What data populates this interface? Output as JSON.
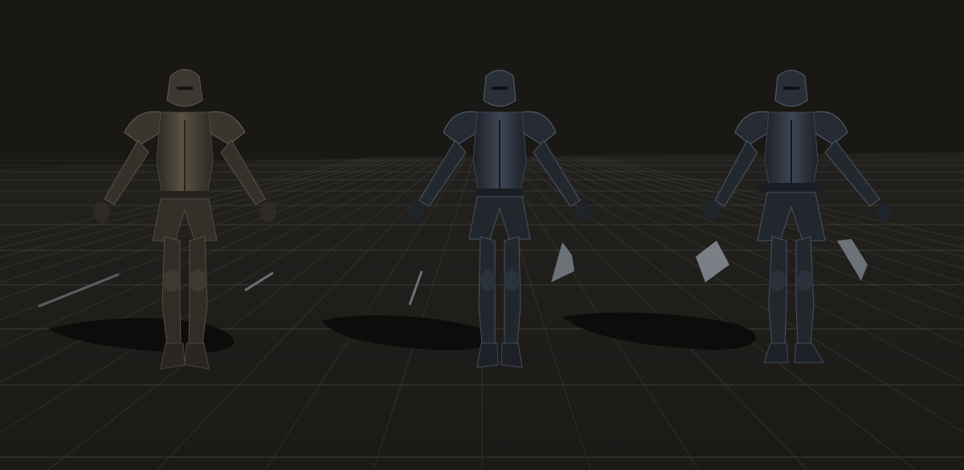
{
  "scene": {
    "colors": {
      "sky": "#1a1815",
      "floor_far": "#211f1c",
      "floor_near": "#1e1c19",
      "grid_line": "#4a4844",
      "shadow": "#0b0a09",
      "armor_bronze": "#3a3630",
      "armor_bronze_highlight": "#6b6250",
      "armor_steel": "#262b33",
      "armor_steel_highlight": "#5a6474",
      "weapon": "#6c7078"
    },
    "characters": [
      {
        "name": "knight-bronze",
        "material": "bronze",
        "weapons": [
          "sword",
          "dagger"
        ]
      },
      {
        "name": "knight-steel-center",
        "material": "steel",
        "weapons": [
          "dagger",
          "shield-shard"
        ]
      },
      {
        "name": "knight-steel-right",
        "material": "steel",
        "weapons": [
          "shield-shard",
          "shield-shard"
        ]
      }
    ]
  }
}
